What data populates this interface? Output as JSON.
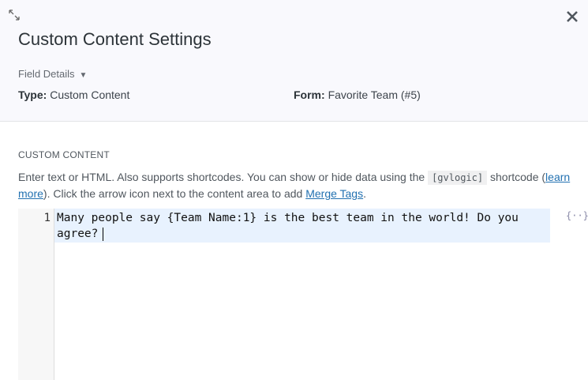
{
  "header": {
    "title": "Custom Content Settings",
    "field_details_label": "Field Details",
    "type_label": "Type:",
    "type_value": "Custom Content",
    "form_label": "Form:",
    "form_value": "Favorite Team (#5)"
  },
  "section": {
    "title": "CUSTOM CONTENT",
    "desc_1": "Enter text or HTML. Also supports shortcodes. You can show or hide data using the ",
    "code": "[gvlogic]",
    "desc_2": " shortcode (",
    "learn_more": "learn more",
    "desc_3": "). Click the arrow icon next to the content area to add ",
    "merge_tags": "Merge Tags",
    "desc_4": "."
  },
  "editor": {
    "line_number": "1",
    "content": "Many people say {Team Name:1} is the best team in the world! Do you agree?",
    "merge_icon": "{··}"
  }
}
